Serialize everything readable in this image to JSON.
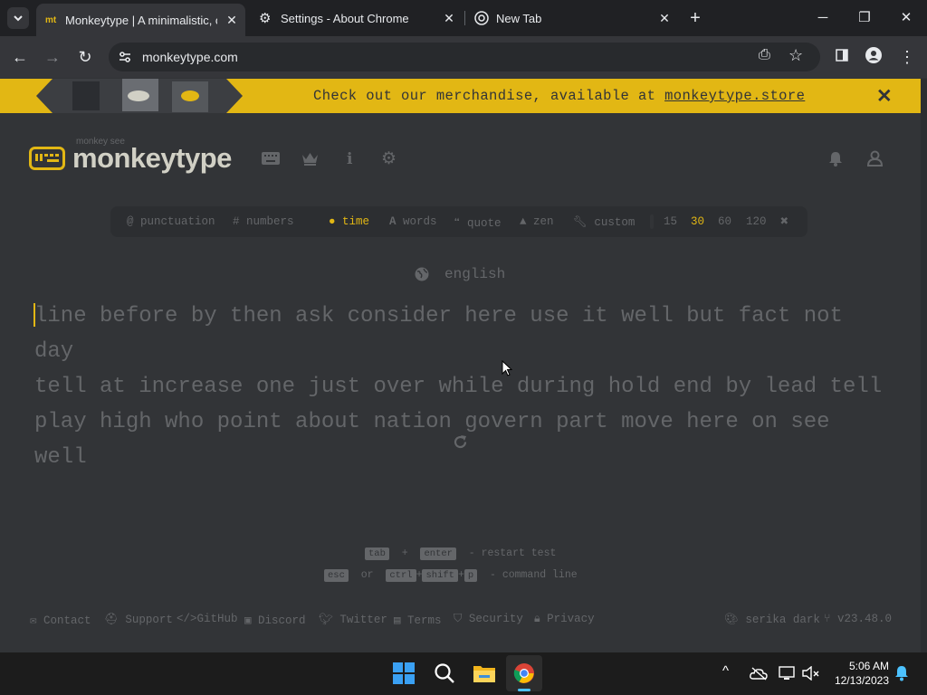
{
  "browser": {
    "tabs": [
      {
        "favicon": "mt",
        "title": "Monkeytype | A minimalistic, cu",
        "active": true
      },
      {
        "favicon": "gear-icon",
        "title": "Settings - About Chrome",
        "active": false
      },
      {
        "favicon": "chrome-icon",
        "title": "New Tab",
        "active": false
      }
    ],
    "url": "monkeytype.com"
  },
  "banner": {
    "text": "Check out our merchandise, available at ",
    "link": "monkeytype.store"
  },
  "header": {
    "logo_small": "monkey see",
    "logo": "monkeytype"
  },
  "config": {
    "punctuation": "punctuation",
    "numbers": "numbers",
    "modes": [
      "time",
      "words",
      "quote",
      "zen",
      "custom"
    ],
    "active_mode": "time",
    "durations": [
      "15",
      "30",
      "60",
      "120"
    ],
    "active_duration": "30"
  },
  "language": "english",
  "words": [
    "line before by then ask consider here use it well but fact not day",
    "tell at increase one just over while during hold end by lead tell",
    "play high who point about nation govern part move here on see well"
  ],
  "hints": {
    "tab": "tab",
    "plus": "+",
    "enter": "enter",
    "restart": "- restart test",
    "esc": "esc",
    "or": "or",
    "ctrl": "ctrl",
    "shift": "shift",
    "p": "p",
    "command": "- command line"
  },
  "footer": {
    "links": [
      "Contact",
      "Support",
      "GitHub",
      "Discord",
      "Twitter",
      "Terms",
      "Security",
      "Privacy"
    ],
    "theme": "serika dark",
    "version": "v23.48.0"
  },
  "taskbar": {
    "time": "5:06 AM",
    "date": "12/13/2023"
  },
  "colors": {
    "bg": "#323437",
    "accent": "#e2b714",
    "sub": "#646669",
    "text": "#d1d0c5"
  }
}
